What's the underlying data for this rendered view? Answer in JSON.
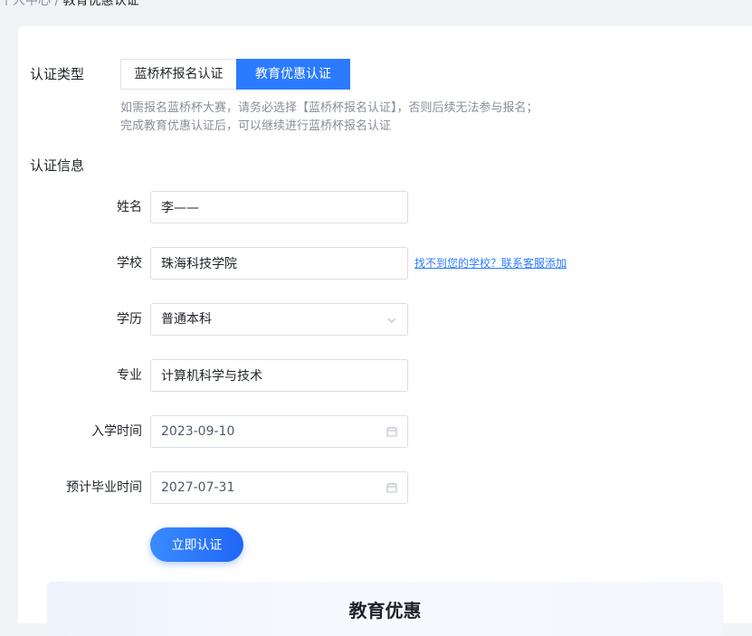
{
  "breadcrumb": {
    "parent": "个人中心",
    "separator": "/",
    "current": "教育优惠认证"
  },
  "cert_type": {
    "label": "认证类型",
    "options": [
      {
        "label": "蓝桥杯报名认证",
        "selected": false
      },
      {
        "label": "教育优惠认证",
        "selected": true
      }
    ],
    "hint_line1": "如需报名蓝桥杯大赛，请务必选择【蓝桥杯报名认证】，否则后续无法参与报名；",
    "hint_line2": "完成教育优惠认证后，可以继续进行蓝桥杯报名认证"
  },
  "cert_info": {
    "label": "认证信息",
    "name": {
      "label": "姓名",
      "value": "李——"
    },
    "school": {
      "label": "学校",
      "value": "珠海科技学院",
      "help_link": "找不到您的学校？联系客服添加"
    },
    "degree": {
      "label": "学历",
      "value": "普通本科"
    },
    "major": {
      "label": "专业",
      "value": "计算机科学与技术"
    },
    "enroll_date": {
      "label": "入学时间",
      "value": "2023-09-10"
    },
    "grad_date": {
      "label": "预计毕业时间",
      "value": "2027-07-31"
    }
  },
  "submit_label": "立即认证",
  "promo": {
    "title": "教育优惠"
  },
  "colors": {
    "accent": "#2b7bff",
    "hint_text": "#8a8f99",
    "background": "#f2f3f5"
  },
  "icons": {
    "select": "chevron-down-icon",
    "date": "calendar-icon"
  }
}
